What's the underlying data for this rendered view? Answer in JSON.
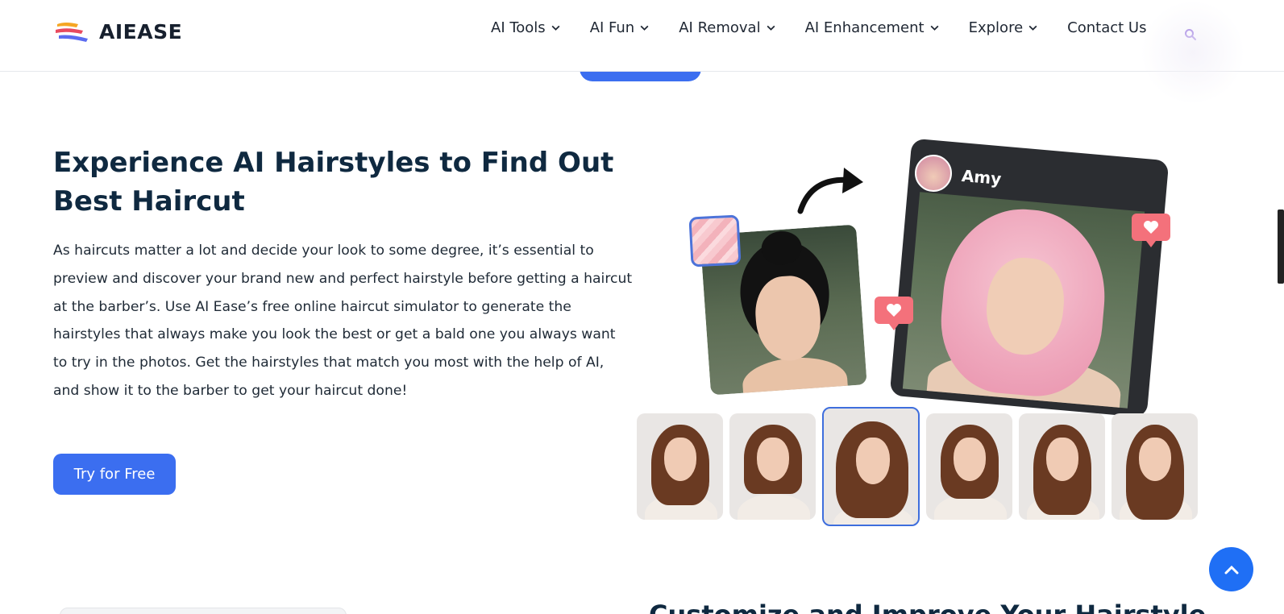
{
  "brand": {
    "name": "AIEASE"
  },
  "nav": {
    "items": [
      {
        "label": "AI Tools",
        "has_dropdown": true
      },
      {
        "label": "AI Fun",
        "has_dropdown": true
      },
      {
        "label": "AI Removal",
        "has_dropdown": true
      },
      {
        "label": "AI Enhancement",
        "has_dropdown": true
      },
      {
        "label": "Explore",
        "has_dropdown": true
      },
      {
        "label": "Contact Us",
        "has_dropdown": false
      }
    ],
    "search_icon": "search-icon"
  },
  "hero": {
    "title": "Experience AI Hairstyles to Find Out Best Haircut",
    "description": "As haircuts matter a lot and decide your look to some degree, it’s essential to preview and discover your brand new and perfect hairstyle before getting a haircut at the barber’s. Use AI Ease’s free online haircut simulator to generate the hairstyles that always make you look the best or get a bald one you always want to try in the photos. Get the hairstyles that match you most with the help of AI, and show it to the barber to get your haircut done!",
    "cta_label": "Try for Free"
  },
  "illustration": {
    "profile_name": "Amy",
    "thumbnails_count": 6,
    "active_thumbnail": 3
  },
  "next_section": {
    "heading": "Customize and Improve Your Hairstyle"
  },
  "colors": {
    "primary": "#3b6ef0",
    "heading": "#0f2940",
    "heart": "#f4717b",
    "scroll_top": "#1f6ff5"
  }
}
